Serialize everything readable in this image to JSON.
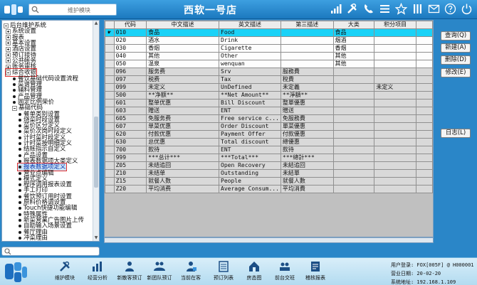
{
  "header": {
    "search_text": "维护模块",
    "store_name": "西软一号店",
    "icons": [
      "signal-icon",
      "tools-icon",
      "phone-icon",
      "menu-icon",
      "star-icon",
      "library-icon",
      "mail-icon",
      "help-icon",
      "power-icon"
    ]
  },
  "tree": {
    "items": [
      {
        "label": "后台维护系统",
        "kind": "minus"
      },
      {
        "label": "系统设置",
        "kind": "plus"
      },
      {
        "label": "报表",
        "kind": "plus"
      },
      {
        "label": "基本设置",
        "kind": "plus"
      },
      {
        "label": "酒店设置",
        "kind": "plus"
      },
      {
        "label": "预订接待",
        "kind": "plus"
      },
      {
        "label": "公共帐务",
        "kind": "plus"
      },
      {
        "label": "账务审核",
        "kind": "plus"
      },
      {
        "label": "综合收银",
        "kind": "minus"
      },
      {
        "label": "餐饮基础代码设置流程",
        "kind": "dot"
      },
      {
        "label": "菜谱管理",
        "kind": "dot"
      },
      {
        "label": "辅料管理",
        "kind": "dot"
      },
      {
        "label": "产品管理",
        "kind": "dot"
      },
      {
        "label": "固定比例荣价",
        "kind": "dot"
      },
      {
        "label": "基础代码",
        "kind": "minus"
      },
      {
        "label": "餐单类别设置",
        "kind": "dot"
      },
      {
        "label": "烧菜时段设置",
        "kind": "dot"
      },
      {
        "label": "菜价区分定义",
        "kind": "dot"
      },
      {
        "label": "菜价次岗时段定义",
        "kind": "dot"
      },
      {
        "label": "计时菜时段定义",
        "kind": "dot"
      },
      {
        "label": "计时菜按明细定义",
        "kind": "dot"
      },
      {
        "label": "结账指示自定义",
        "kind": "dot"
      },
      {
        "label": "产品设置",
        "kind": "dot"
      },
      {
        "label": "报表数据项大类定义",
        "kind": "dot"
      },
      {
        "label": "报表数据项定义",
        "kind": "dot"
      },
      {
        "label": "营业点编辑",
        "kind": "dot"
      },
      {
        "label": "模式定义",
        "kind": "dot"
      },
      {
        "label": "程序调用报表设置",
        "kind": "dot"
      },
      {
        "label": "手工打印",
        "kind": "dot"
      },
      {
        "label": "餐饮预订用时设置",
        "kind": "dot"
      },
      {
        "label": "原料价格调设置",
        "kind": "dot"
      },
      {
        "label": "Touch快捷功能编辑",
        "kind": "dot"
      },
      {
        "label": "特殊属性",
        "kind": "dot"
      },
      {
        "label": "新菜营業广告图片上传",
        "kind": "dot"
      },
      {
        "label": "自助输入场景设置",
        "kind": "dot"
      },
      {
        "label": "餐厅理由",
        "kind": "dot"
      },
      {
        "label": "冲菜理由",
        "kind": "dot"
      }
    ]
  },
  "grid": {
    "columns": [
      "代码",
      "中文描述",
      "英文描述",
      "第三描述",
      "大类",
      "积分项目"
    ],
    "rows": [
      [
        "010",
        "食品",
        "Food",
        "",
        "食品",
        ""
      ],
      [
        "020",
        "酒水",
        "Drink",
        "",
        "烟酒",
        ""
      ],
      [
        "030",
        "香烟",
        "Cigarette",
        "",
        "香烟",
        ""
      ],
      [
        "040",
        "其他",
        "Other",
        "",
        "其他",
        ""
      ],
      [
        "050",
        "温泉",
        "wenquan",
        "",
        "其他",
        ""
      ],
      [
        "096",
        "服务费",
        "Srv",
        "服務費",
        "",
        ""
      ],
      [
        "097",
        "税费",
        "Tax",
        "稅費",
        "",
        ""
      ],
      [
        "099",
        "未定义",
        "UnDefined",
        "未定義",
        "",
        "未定义"
      ],
      [
        "500",
        "**净额**",
        "**Net Amount**",
        "**淨額**",
        "",
        ""
      ],
      [
        "601",
        "整单优惠",
        "Bill Discount",
        "整單優惠",
        "",
        ""
      ],
      [
        "603",
        "赠送",
        "ENT",
        "贈送",
        "",
        ""
      ],
      [
        "605",
        "免服务费",
        "Free service c...",
        "免服務費",
        "",
        ""
      ],
      [
        "607",
        "单菜优惠",
        "Order Discount",
        "單菜優惠",
        "",
        ""
      ],
      [
        "620",
        "付款优惠",
        "Payment Offer",
        "付款優惠",
        "",
        ""
      ],
      [
        "630",
        "总优惠",
        "Total discount",
        "總優惠",
        "",
        ""
      ],
      [
        "700",
        "款待",
        "ENT",
        "款待",
        "",
        ""
      ],
      [
        "999",
        "***总计***",
        "***Total***",
        "***總計***",
        "",
        ""
      ],
      [
        "Z05",
        "未结追回",
        "Open Recovery",
        "未結追回",
        "",
        ""
      ],
      [
        "Z10",
        "未结单",
        "Outstanding",
        "未結單",
        "",
        ""
      ],
      [
        "Z15",
        "就餐人数",
        "People",
        "就餐人數",
        "",
        ""
      ],
      [
        "Z20",
        "平均消费",
        "Average Consum...",
        "平均消費",
        "",
        ""
      ]
    ]
  },
  "buttons": {
    "query": "查询(Q)",
    "new": "新建(A)",
    "delete": "删除(D)",
    "modify": "修改(E)",
    "log": "日志(L)"
  },
  "bottom_nav": [
    {
      "label": "维护模块",
      "icon": "tools-icon"
    },
    {
      "label": "经营分析",
      "icon": "bar-chart-icon"
    },
    {
      "label": "新散客预订",
      "icon": "new-guest-icon"
    },
    {
      "label": "新团队预订",
      "icon": "group-booking-icon"
    },
    {
      "label": "当前在客",
      "icon": "guest-icon"
    },
    {
      "label": "预订列表",
      "icon": "list-icon"
    },
    {
      "label": "房态图",
      "icon": "house-icon"
    },
    {
      "label": "前台交班",
      "icon": "shift-icon"
    },
    {
      "label": "稽核报表",
      "icon": "audit-report-icon"
    }
  ],
  "status": {
    "user": "用户登录: FOX[005F] @ H000001",
    "business_date": "营业日期: 20-02-20",
    "address": "系统地址: 192.168.1.109"
  }
}
